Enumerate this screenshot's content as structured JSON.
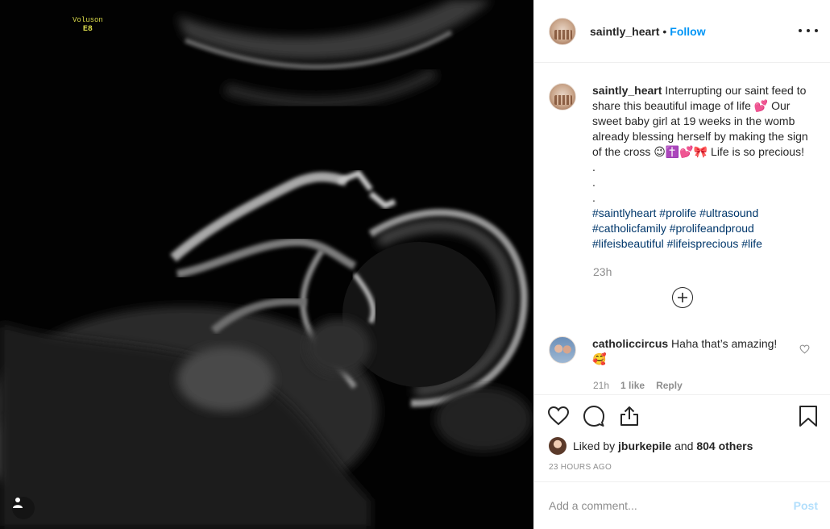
{
  "media": {
    "device_brand": "Voluson",
    "device_model": "E8"
  },
  "header": {
    "username": "saintly_heart",
    "separator": "•",
    "follow_label": "Follow"
  },
  "caption": {
    "username": "saintly_heart",
    "text": "Interrupting our saint feed to share this beautiful image of life 💕 Our sweet baby girl at 19 weeks in the womb already blessing herself by making the sign of the cross 😉✝️💕🎀 Life is so precious! .",
    "dot_line_1": ".",
    "dot_line_2": ".",
    "hashtags": [
      "#saintlyheart",
      "#prolife",
      "#ultrasound",
      "#catholicfamily",
      "#prolifeandproud",
      "#lifeisbeautiful",
      "#lifeisprecious",
      "#life"
    ],
    "time": "23h"
  },
  "comment": {
    "username": "catholiccircus",
    "text": "Haha that’s amazing! 🥰",
    "time": "21h",
    "likes": "1 like",
    "reply": "Reply"
  },
  "likes": {
    "prefix": "Liked by",
    "liker": "jburkepile",
    "conjunction": "and",
    "others": "804 others"
  },
  "post_time": "23 HOURS AGO",
  "add_comment": {
    "placeholder": "Add a comment...",
    "post_label": "Post"
  },
  "icons": {
    "more": "more-options-icon",
    "like": "heart-icon",
    "comment": "comment-bubble-icon",
    "share": "share-icon",
    "save": "bookmark-icon",
    "load_more": "plus-circle-icon",
    "tag_user": "user-icon"
  },
  "colors": {
    "follow": "#0095f6",
    "hashtag": "#00376b",
    "post_disabled": "#b2dffc",
    "muted": "#8e8e8e"
  }
}
